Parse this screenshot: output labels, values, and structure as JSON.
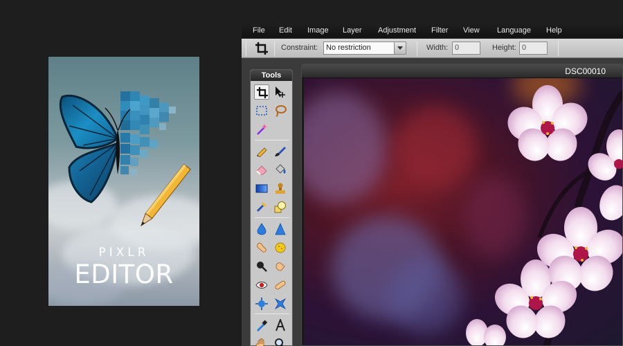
{
  "splash": {
    "brand": "PIXLR",
    "product": "EDITOR"
  },
  "menubar": {
    "items": [
      "File",
      "Edit",
      "Image",
      "Layer",
      "Adjustment",
      "Filter",
      "View",
      "Language",
      "Help"
    ]
  },
  "options": {
    "tool_icon": "crop-icon",
    "constraint_label": "Constraint:",
    "constraint_value": "No restriction",
    "width_label": "Width:",
    "width_value": "0",
    "height_label": "Height:",
    "height_value": "0"
  },
  "tools": {
    "title": "Tools",
    "active": "crop-tool",
    "icons": [
      "crop-icon",
      "move-icon",
      "marquee-icon",
      "lasso-icon",
      "magic-wand-icon",
      "pencil-icon",
      "brush-icon",
      "eraser-icon",
      "paint-bucket-icon",
      "gradient-icon",
      "clone-stamp-icon",
      "color-replace-icon",
      "drawing-icon",
      "blur-icon",
      "sharpen-icon",
      "smudge-icon",
      "sponge-icon",
      "dodge-icon",
      "burn-icon",
      "red-eye-icon",
      "spot-heal-icon",
      "bloat-icon",
      "pinch-icon",
      "color-picker-icon",
      "type-icon",
      "hand-icon",
      "zoom-icon"
    ]
  },
  "document": {
    "title": "DSC00010"
  },
  "colors": {
    "app_background": "#1e1e1e",
    "menubar": "#1a1a1a",
    "options_bar": "#c9c9c9",
    "tools_panel": "#c9c9c9",
    "blossom_pink": "#f2d9e6",
    "blossom_center": "#b0154a"
  }
}
